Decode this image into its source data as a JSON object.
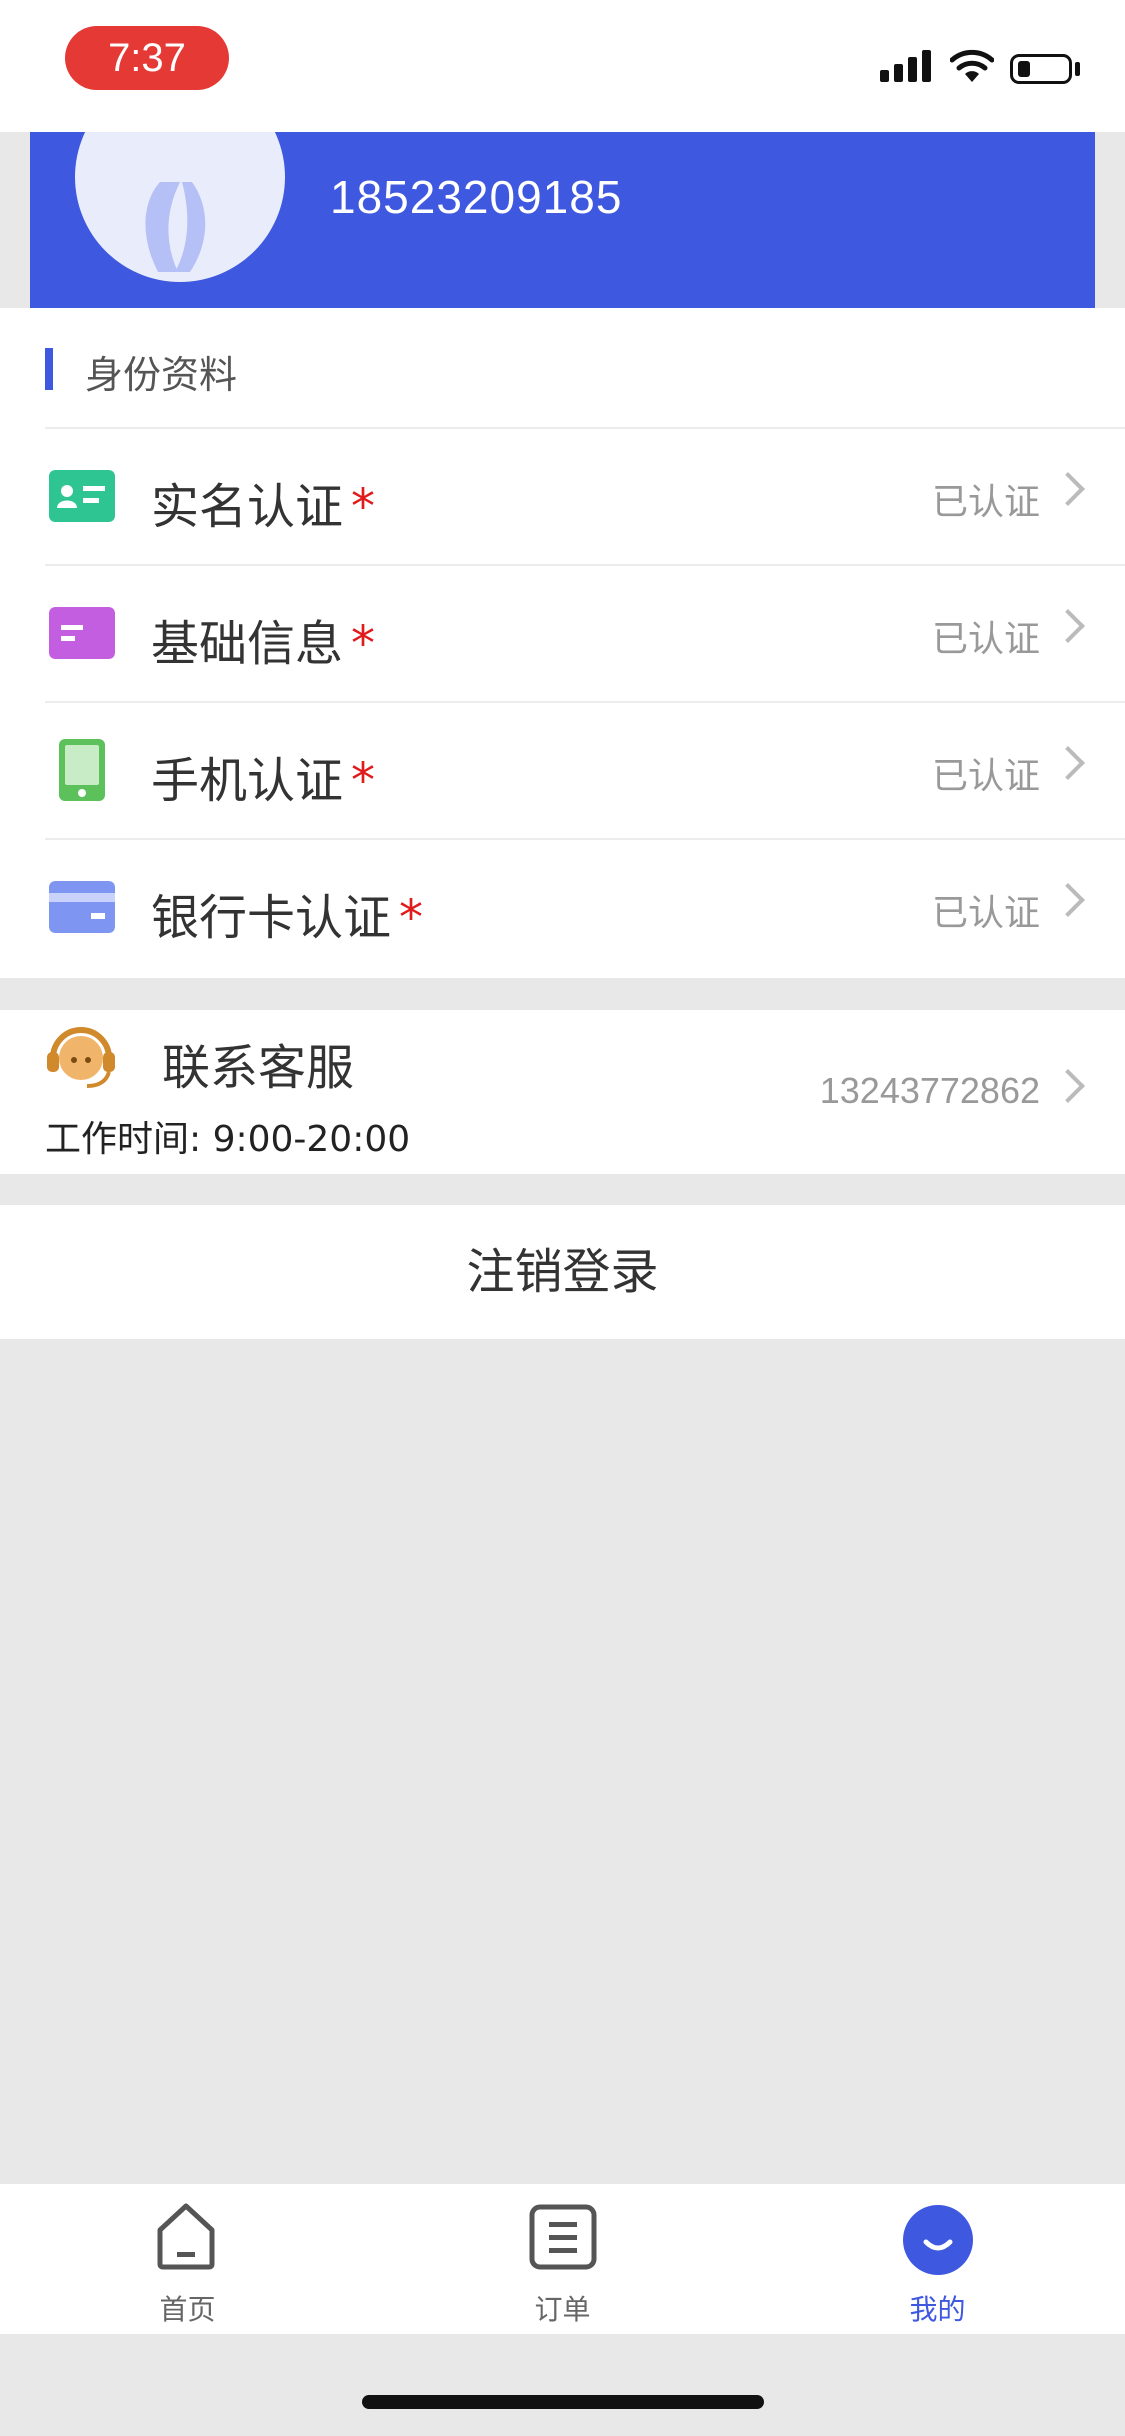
{
  "status_bar": {
    "time": "7:37"
  },
  "profile": {
    "phone": "18523209185"
  },
  "identity": {
    "title": "身份资料",
    "items": [
      {
        "label": "实名认证",
        "status": "已认证",
        "icon": "id-card-icon",
        "color": "#2fc592"
      },
      {
        "label": "基础信息",
        "status": "已认证",
        "icon": "info-card-icon",
        "color": "#c35ee0"
      },
      {
        "label": "手机认证",
        "status": "已认证",
        "icon": "phone-icon",
        "color": "#5cc15a"
      },
      {
        "label": "银行卡认证",
        "status": "已认证",
        "icon": "bank-card-icon",
        "color": "#7f95f2"
      }
    ]
  },
  "contact": {
    "title": "联系客服",
    "hours": "工作时间: 9:00-20:00",
    "phone": "13243772862"
  },
  "logout_label": "注销登录",
  "tabs": [
    {
      "label": "首页",
      "icon": "home-icon"
    },
    {
      "label": "订单",
      "icon": "orders-icon"
    },
    {
      "label": "我的",
      "icon": "profile-icon",
      "active": true
    }
  ],
  "colors": {
    "brand": "#3f58e0",
    "required": "#e01b1b",
    "status_text": "#999999"
  }
}
